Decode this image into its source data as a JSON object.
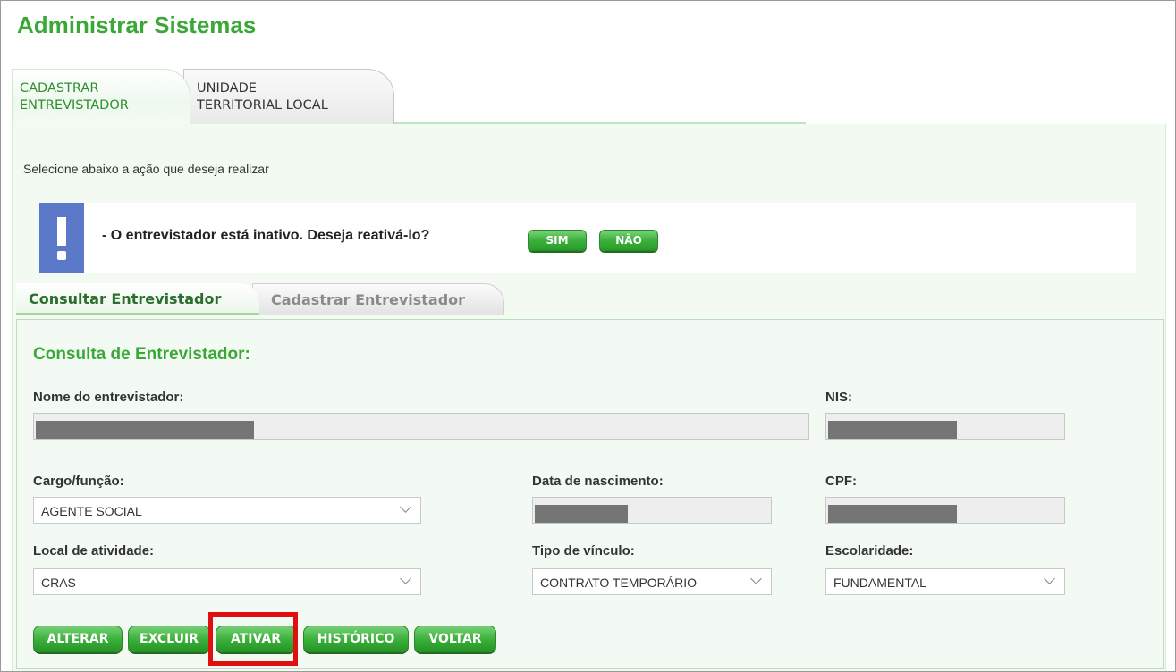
{
  "page": {
    "title": "Administrar Sistemas"
  },
  "top_tabs": [
    {
      "label": "CADASTRAR\nENTREVISTADOR",
      "active": true
    },
    {
      "label": "UNIDADE\nTERRITORIAL LOCAL",
      "active": false
    }
  ],
  "instruction": "Selecione abaixo a ação que deseja realizar",
  "alert": {
    "icon": "exclamation-icon",
    "message": "- O entrevistador está inativo. Deseja reativá-lo?",
    "yes_label": "SIM",
    "no_label": "NÃO",
    "icon_color": "#5b78c9"
  },
  "inner_tabs": [
    {
      "label": "Consultar Entrevistador",
      "active": true
    },
    {
      "label": "Cadastrar Entrevistador",
      "active": false
    }
  ],
  "form": {
    "title": "Consulta de Entrevistador:",
    "nome_label": "Nome do entrevistador:",
    "nis_label": "NIS:",
    "cargo_label": "Cargo/função:",
    "cargo_value": "AGENTE SOCIAL",
    "data_nasc_label": "Data de nascimento:",
    "cpf_label": "CPF:",
    "local_label": "Local de atividade:",
    "local_value": "CRAS",
    "tipo_vinculo_label": "Tipo de vínculo:",
    "tipo_vinculo_value": "CONTRATO TEMPORÁRIO",
    "escolaridade_label": "Escolaridade:",
    "escolaridade_value": "FUNDAMENTAL"
  },
  "actions": {
    "alterar": "ALTERAR",
    "excluir": "EXCLUIR",
    "ativar": "ATIVAR",
    "historico": "HISTÓRICO",
    "voltar": "VOLTAR"
  },
  "colors": {
    "brand_green": "#3aa836",
    "highlight_red": "#e01010"
  }
}
